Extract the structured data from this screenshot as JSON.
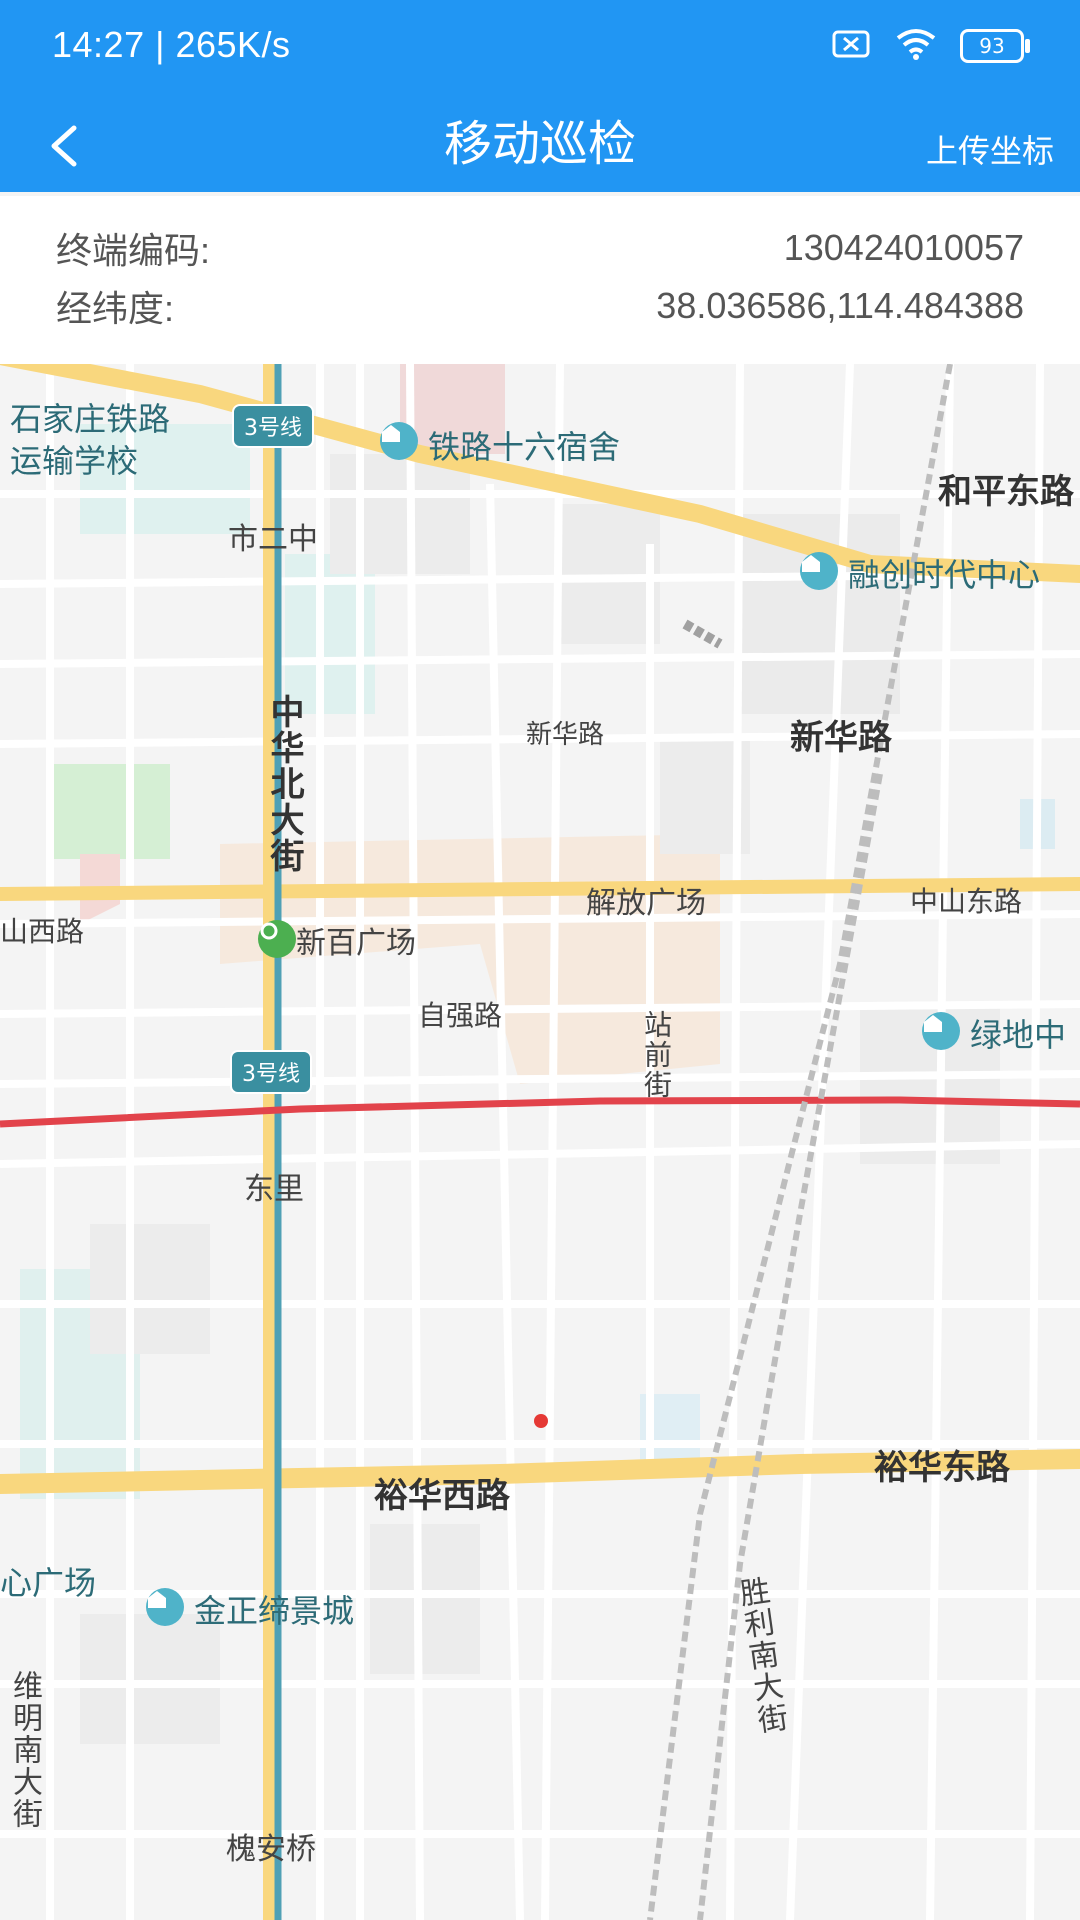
{
  "status_bar": {
    "time_net": "14:27 | 265K/s",
    "battery": "93"
  },
  "header": {
    "title": "移动巡检",
    "action": "上传坐标"
  },
  "info": {
    "terminal_label": "终端编码:",
    "terminal_value": "130424010057",
    "coord_label": "经纬度:",
    "coord_value": "38.036586,114.484388"
  },
  "map_labels": {
    "line3_top": "3号线",
    "line3_bottom": "3号线",
    "school": "石家庄铁路\n运输学校",
    "dorm": "铁路十六宿舍",
    "hepingdong": "和平东路",
    "rongchuang": "融创时代中心",
    "shierzhong": "市二中",
    "xinhualu_small": "新华路",
    "xinhualu_big": "新华路",
    "zhonghuabei": "中华北大街",
    "jiefang": "解放广场",
    "zhongshandong": "中山东路",
    "zhongshanxi": "山西路",
    "xinbai": "新百广场",
    "ziqiang": "自强路",
    "zhanqian": "站前街",
    "lvdi": "绿地中",
    "dongli": "东里",
    "yuhuaxi": "裕华西路",
    "yuhuadong": "裕华东路",
    "xinguangchang": "心广场",
    "jinzheng": "金正缔景城",
    "shengli": "胜利南大街",
    "weiming": "维明南大街",
    "huaian": "槐安桥"
  }
}
